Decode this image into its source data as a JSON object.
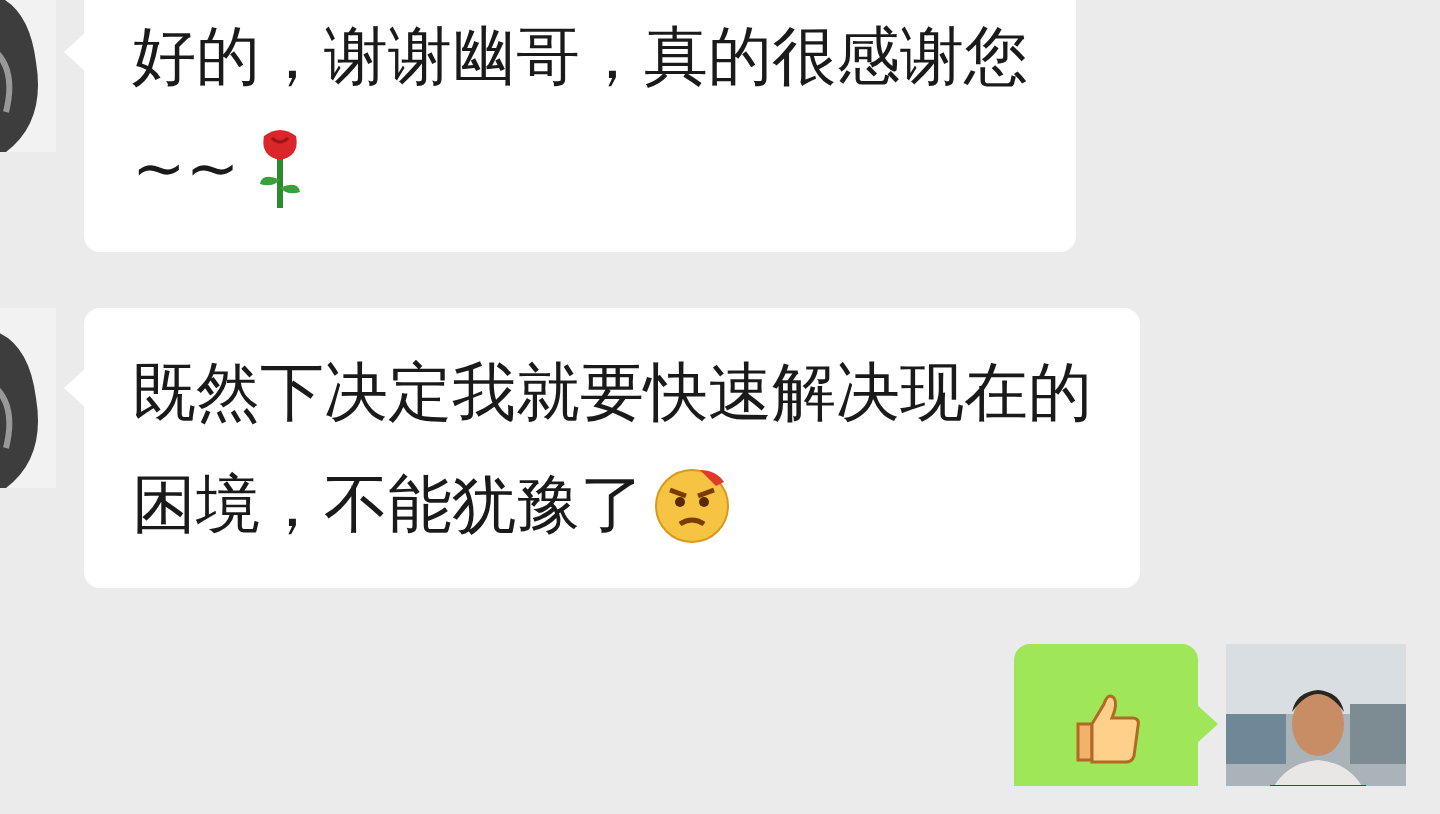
{
  "messages": [
    {
      "kind": "incoming",
      "lines": [
        [
          {
            "kind": "text",
            "text": "好的，谢谢幽哥，真的很感谢您"
          }
        ],
        [
          {
            "kind": "text",
            "text": "~~"
          },
          {
            "kind": "rose"
          }
        ]
      ]
    },
    {
      "kind": "incoming",
      "lines": [
        [
          {
            "kind": "text",
            "text": "既然下决定我就要快速解决现在的"
          }
        ],
        [
          {
            "kind": "text",
            "text": "困境，不能犹豫了"
          },
          {
            "kind": "angry"
          }
        ]
      ]
    },
    {
      "kind": "outgoing",
      "lines": [
        [
          {
            "kind": "thumbs"
          }
        ]
      ]
    }
  ]
}
